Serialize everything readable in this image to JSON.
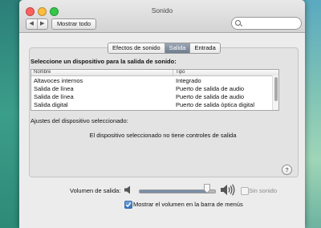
{
  "window": {
    "title": "Sonido",
    "back_icon": "chevron-left-icon",
    "forward_icon": "chevron-right-icon",
    "show_all_label": "Mostrar todo",
    "search_placeholder": ""
  },
  "tabs": [
    {
      "label": "Efectos de sonido",
      "active": false
    },
    {
      "label": "Salida",
      "active": true
    },
    {
      "label": "Entrada",
      "active": false
    }
  ],
  "output": {
    "heading": "Seleccione un dispositivo para la salida de sonido:",
    "columns": [
      "Nombre",
      "Tipo"
    ],
    "devices": [
      {
        "name": "Altavoces internos",
        "type": "Integrado"
      },
      {
        "name": "Salida de línea",
        "type": "Puerto de salida de audio"
      },
      {
        "name": "Salida de línea",
        "type": "Puerto de salida de audio"
      },
      {
        "name": "Salida digital",
        "type": "Puerto de salida óptica digital"
      }
    ],
    "settings_label": "Ajustes del dispositivo seleccionado:",
    "no_controls_message": "El dispositivo seleccionado no tiene controles de salida",
    "help_label": "?"
  },
  "volume": {
    "label": "Volumen de salida:",
    "level": 0.9,
    "mute_label": "Sin sonido",
    "mute_checked": false,
    "show_in_menubar_label": "Mostrar el volumen en la barra de menús",
    "show_in_menubar_checked": true
  },
  "colors": {
    "tab_active": "#7f8c9c",
    "checkbox_accent": "#2f6fc0"
  }
}
